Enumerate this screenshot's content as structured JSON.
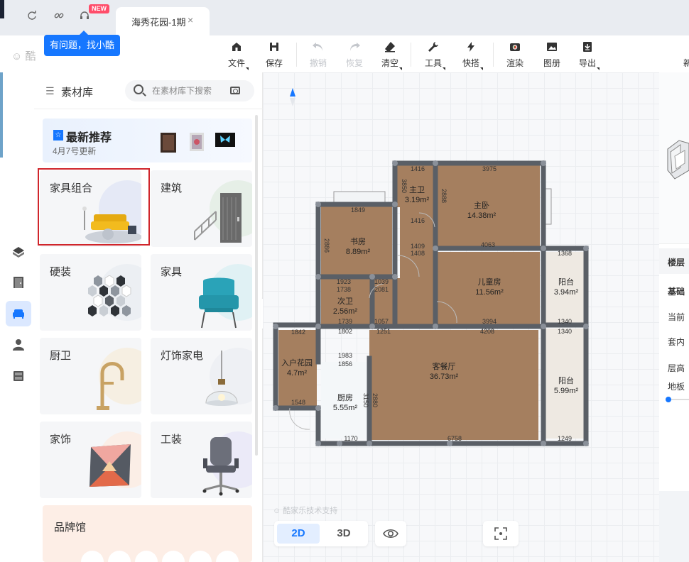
{
  "tabbar": {
    "icons": [
      "refresh-icon",
      "link-icon",
      "headset-icon"
    ],
    "new_badge": "NEW",
    "tab_title": "海秀花园-1期",
    "tab_close": "×",
    "tooltip": "有问题，找小酷"
  },
  "toolbar": {
    "logo": "酷",
    "tools": [
      {
        "label": "文件",
        "icon": "file-icon"
      },
      {
        "label": "保存",
        "icon": "save-icon"
      },
      {
        "label": "撤销",
        "icon": "undo-icon",
        "disabled": true
      },
      {
        "label": "恢复",
        "icon": "redo-icon",
        "disabled": true
      },
      {
        "label": "清空",
        "icon": "eraser-icon"
      },
      {
        "label": "工具",
        "icon": "wrench-icon"
      },
      {
        "label": "快搭",
        "icon": "lightning-icon"
      },
      {
        "label": "渲染",
        "icon": "camera-icon"
      },
      {
        "label": "图册",
        "icon": "album-icon"
      },
      {
        "label": "导出",
        "icon": "export-icon"
      }
    ],
    "overflow": "新"
  },
  "panel": {
    "title": "素材库",
    "search_placeholder": "在素材库下搜索",
    "recommend": {
      "title": "最新推荐",
      "subtitle": "4月7号更新"
    },
    "categories": [
      "家具组合",
      "建筑",
      "硬装",
      "家具",
      "厨卫",
      "灯饰家电",
      "家饰",
      "工装"
    ],
    "brand": "品牌馆",
    "selected": "家具组合"
  },
  "floorplan": {
    "rooms": [
      {
        "name": "主卫",
        "area": "3.19m²"
      },
      {
        "name": "主卧",
        "area": "14.38m²"
      },
      {
        "name": "书房",
        "area": "8.89m²"
      },
      {
        "name": "儿童房",
        "area": "11.56m²"
      },
      {
        "name": "阳台",
        "area": "3.94m²"
      },
      {
        "name": "次卫",
        "area": "2.56m²"
      },
      {
        "name": "入户花园",
        "area": "4.7m²"
      },
      {
        "name": "厨房",
        "area": "5.55m²"
      },
      {
        "name": "客餐厅",
        "area": "36.73m²"
      },
      {
        "name": "阳台",
        "area": "5.99m²"
      }
    ],
    "dims": [
      "1416",
      "3975",
      "3850",
      "1849",
      "1416",
      "2888",
      "1409",
      "4063",
      "1408",
      "1368",
      "2886",
      "1923",
      "1738",
      "1039",
      "2081",
      "3994",
      "1340",
      "1739",
      "1057",
      "1842",
      "1802",
      "1251",
      "4208",
      "1340",
      "1983",
      "1856",
      "1548",
      "1170",
      "6758",
      "1249",
      "3150",
      "2880"
    ]
  },
  "canvas": {
    "tech_support": "酷家乐技术支持",
    "view_2d": "2D",
    "view_3d": "3D"
  },
  "right_panel": {
    "header": "楼层",
    "section": "基础",
    "rows": [
      "当前",
      "套内",
      "层高",
      "地板"
    ]
  },
  "colors": {
    "accent": "#1677ff",
    "highlight": "#d0252b",
    "wall": "#5a5f66",
    "floor": "#a27d5e"
  }
}
